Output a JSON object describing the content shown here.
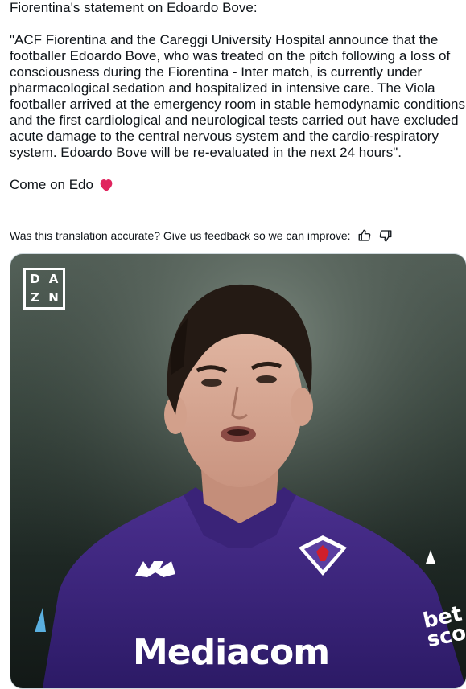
{
  "tweet": {
    "title_line": "Fiorentina's statement on Edoardo Bove:",
    "quote": "\"ACF Fiorentina and the Careggi University Hospital announce that the footballer Edoardo Bove, who was treated on the pitch following a loss of consciousness during the Fiorentina - Inter match, is currently under pharmacological sedation and hospitalized in intensive care. The Viola footballer arrived at the emergency room in stable hemodynamic conditions and the first cardiological and neurological tests carried out have excluded acute damage to the central nervous system and the cardio-respiratory system. Edoardo Bove will be re-evaluated in the next 24 hours\".",
    "closing": "Come on Edo",
    "heart_color": "#e0245e"
  },
  "feedback": {
    "text": "Was this translation accurate? Give us feedback so we can improve:",
    "thumbs_up_icon": "thumbs-up-icon",
    "thumbs_down_icon": "thumbs-down-icon"
  },
  "media": {
    "logo_letters": [
      "D",
      "A",
      "Z",
      "N"
    ],
    "sponsor_text": "Mediacom",
    "kit_brand": "Kappa",
    "side_sponsor": "bet\nsco"
  }
}
